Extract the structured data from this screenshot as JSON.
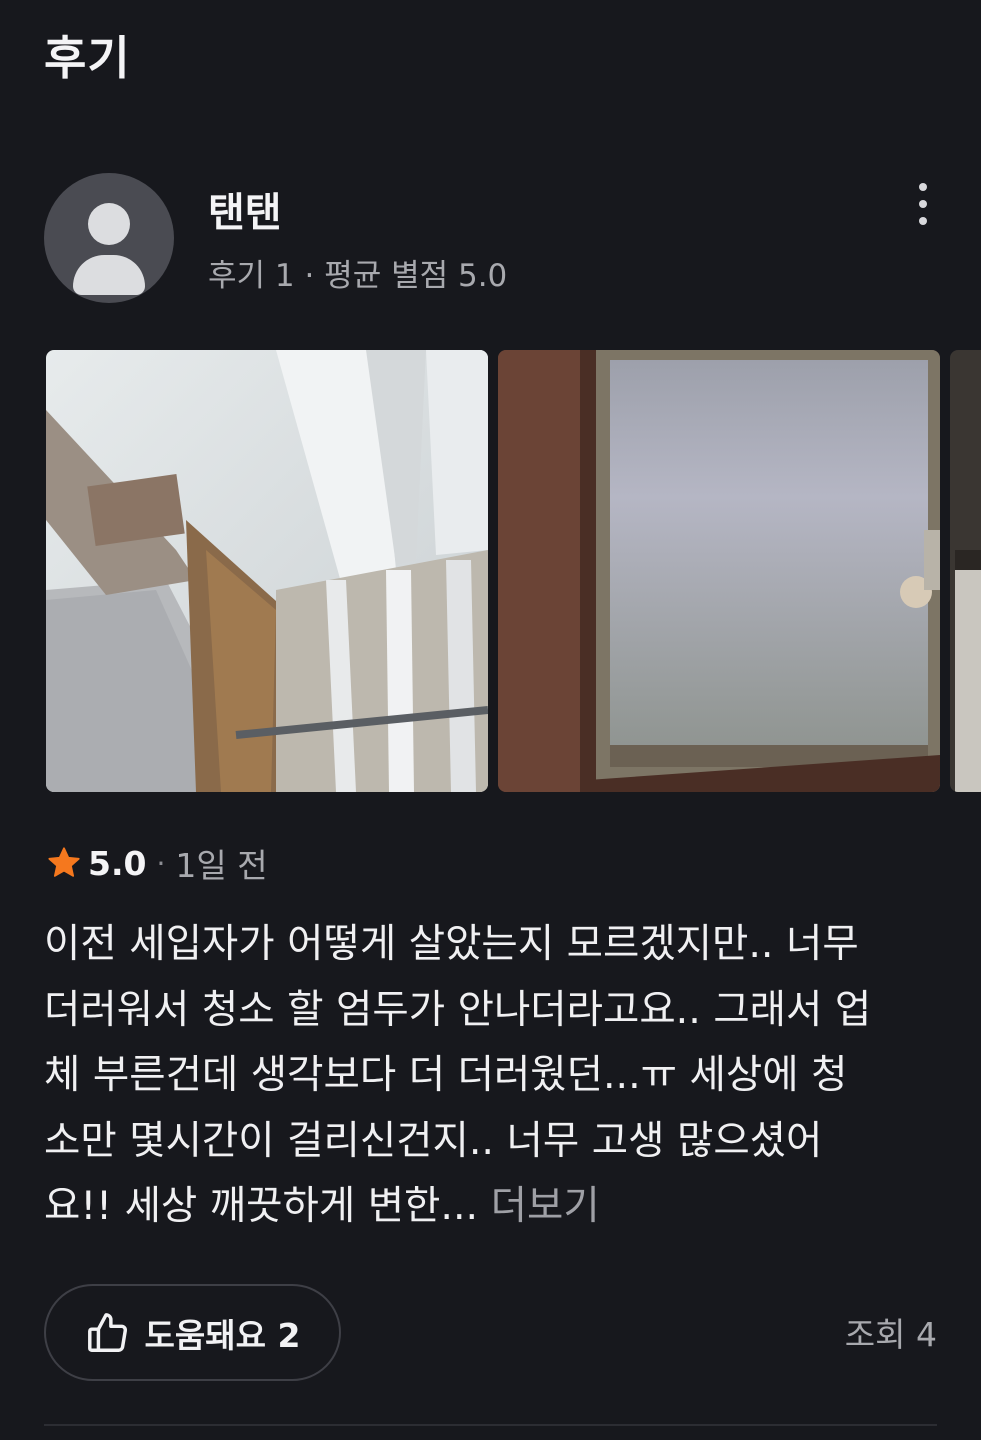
{
  "section": {
    "title": "후기"
  },
  "reviewer": {
    "name": "탠탠",
    "meta": "후기 1 · 평균 별점 5.0"
  },
  "photos": [
    {
      "icon": "window-track-photo"
    },
    {
      "icon": "frosted-glass-window-photo"
    },
    {
      "icon": "window-photo-partial"
    }
  ],
  "rating": {
    "value": "5.0",
    "separator": "·",
    "time": "1일 전",
    "star_color": "#f5781e"
  },
  "review": {
    "lines": [
      "이전 세입자가 어떻게 살았는지 모르겠지만.. 너무",
      "더러워서 청소 할 엄두가 안나더라고요.. 그래서 업",
      "체 부른건데 생각보다 더 더러웠던...ㅠ 세상에 청",
      "소만 몇시간이 걸리신건지.. 너무 고생 많으셨어",
      "요!! 세상 깨끗하게 변한..."
    ],
    "more_label": "더보기"
  },
  "actions": {
    "helpful_label": "도움돼요 2",
    "views": "조회 4"
  },
  "colors": {
    "background": "#17181d",
    "accent": "#f5781e"
  }
}
